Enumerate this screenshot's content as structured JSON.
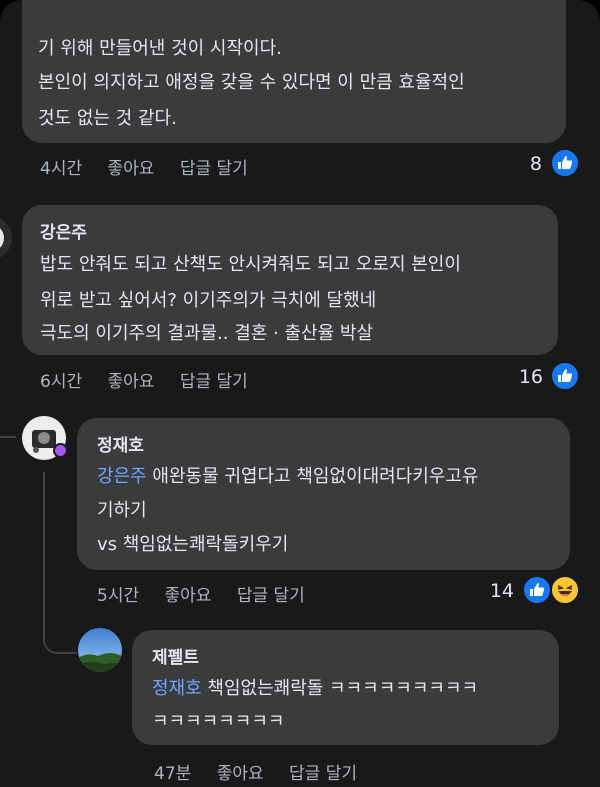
{
  "comment1": {
    "partial_top": "기 위해 만들어낸 것이 시작이다.",
    "line1": "본인이 의지하고 애정을 갖을 수 있다면 이 만큼 효율적인",
    "line2": "것도 없는 것 같다.",
    "time": "4시간",
    "like_label": "좋아요",
    "reply_label": "답글 달기",
    "reaction_count": "8"
  },
  "comment2": {
    "author": "강은주",
    "line1": "밥도 안줘도 되고 산책도 안시켜줘도 되고 오로지 본인이",
    "line2": "위로 받고 싶어서?  이기주의가 극치에 달했네",
    "line3": "극도의 이기주의 결과물..   결혼 · 출산율 박살",
    "time": "6시간",
    "like_label": "좋아요",
    "reply_label": "답글 달기",
    "reaction_count": "16"
  },
  "reply1": {
    "author": "정재호",
    "mention": "강은주",
    "line1_rest": " 애완동물 귀엽다고 책임없이대려다키우고유",
    "line2": "기하기",
    "line3": "vs 책임없는쾌락돌키우기",
    "time": "5시간",
    "like_label": "좋아요",
    "reply_label": "답글 달기",
    "reaction_count": "14"
  },
  "reply2": {
    "author": "제펠트",
    "mention": "정재호",
    "line1_rest": " 책임없는쾌락돌 ㅋㅋㅋㅋㅋㅋㅋㅋㅋ",
    "line2": "ㅋㅋㅋㅋㅋㅋㅋㅋ",
    "time": "47분",
    "like_label": "좋아요",
    "reply_label": "답글 달기"
  },
  "colors": {
    "background": "#18191a",
    "bubble": "#3a3b3c",
    "mention": "#6ea8ff",
    "like_blue": "#1877f2",
    "meta_gray": "#b0b3b8"
  },
  "icons": {
    "like": "thumbs-up-icon",
    "haha": "laughing-face-icon",
    "story_ring": "story-ring-icon"
  }
}
